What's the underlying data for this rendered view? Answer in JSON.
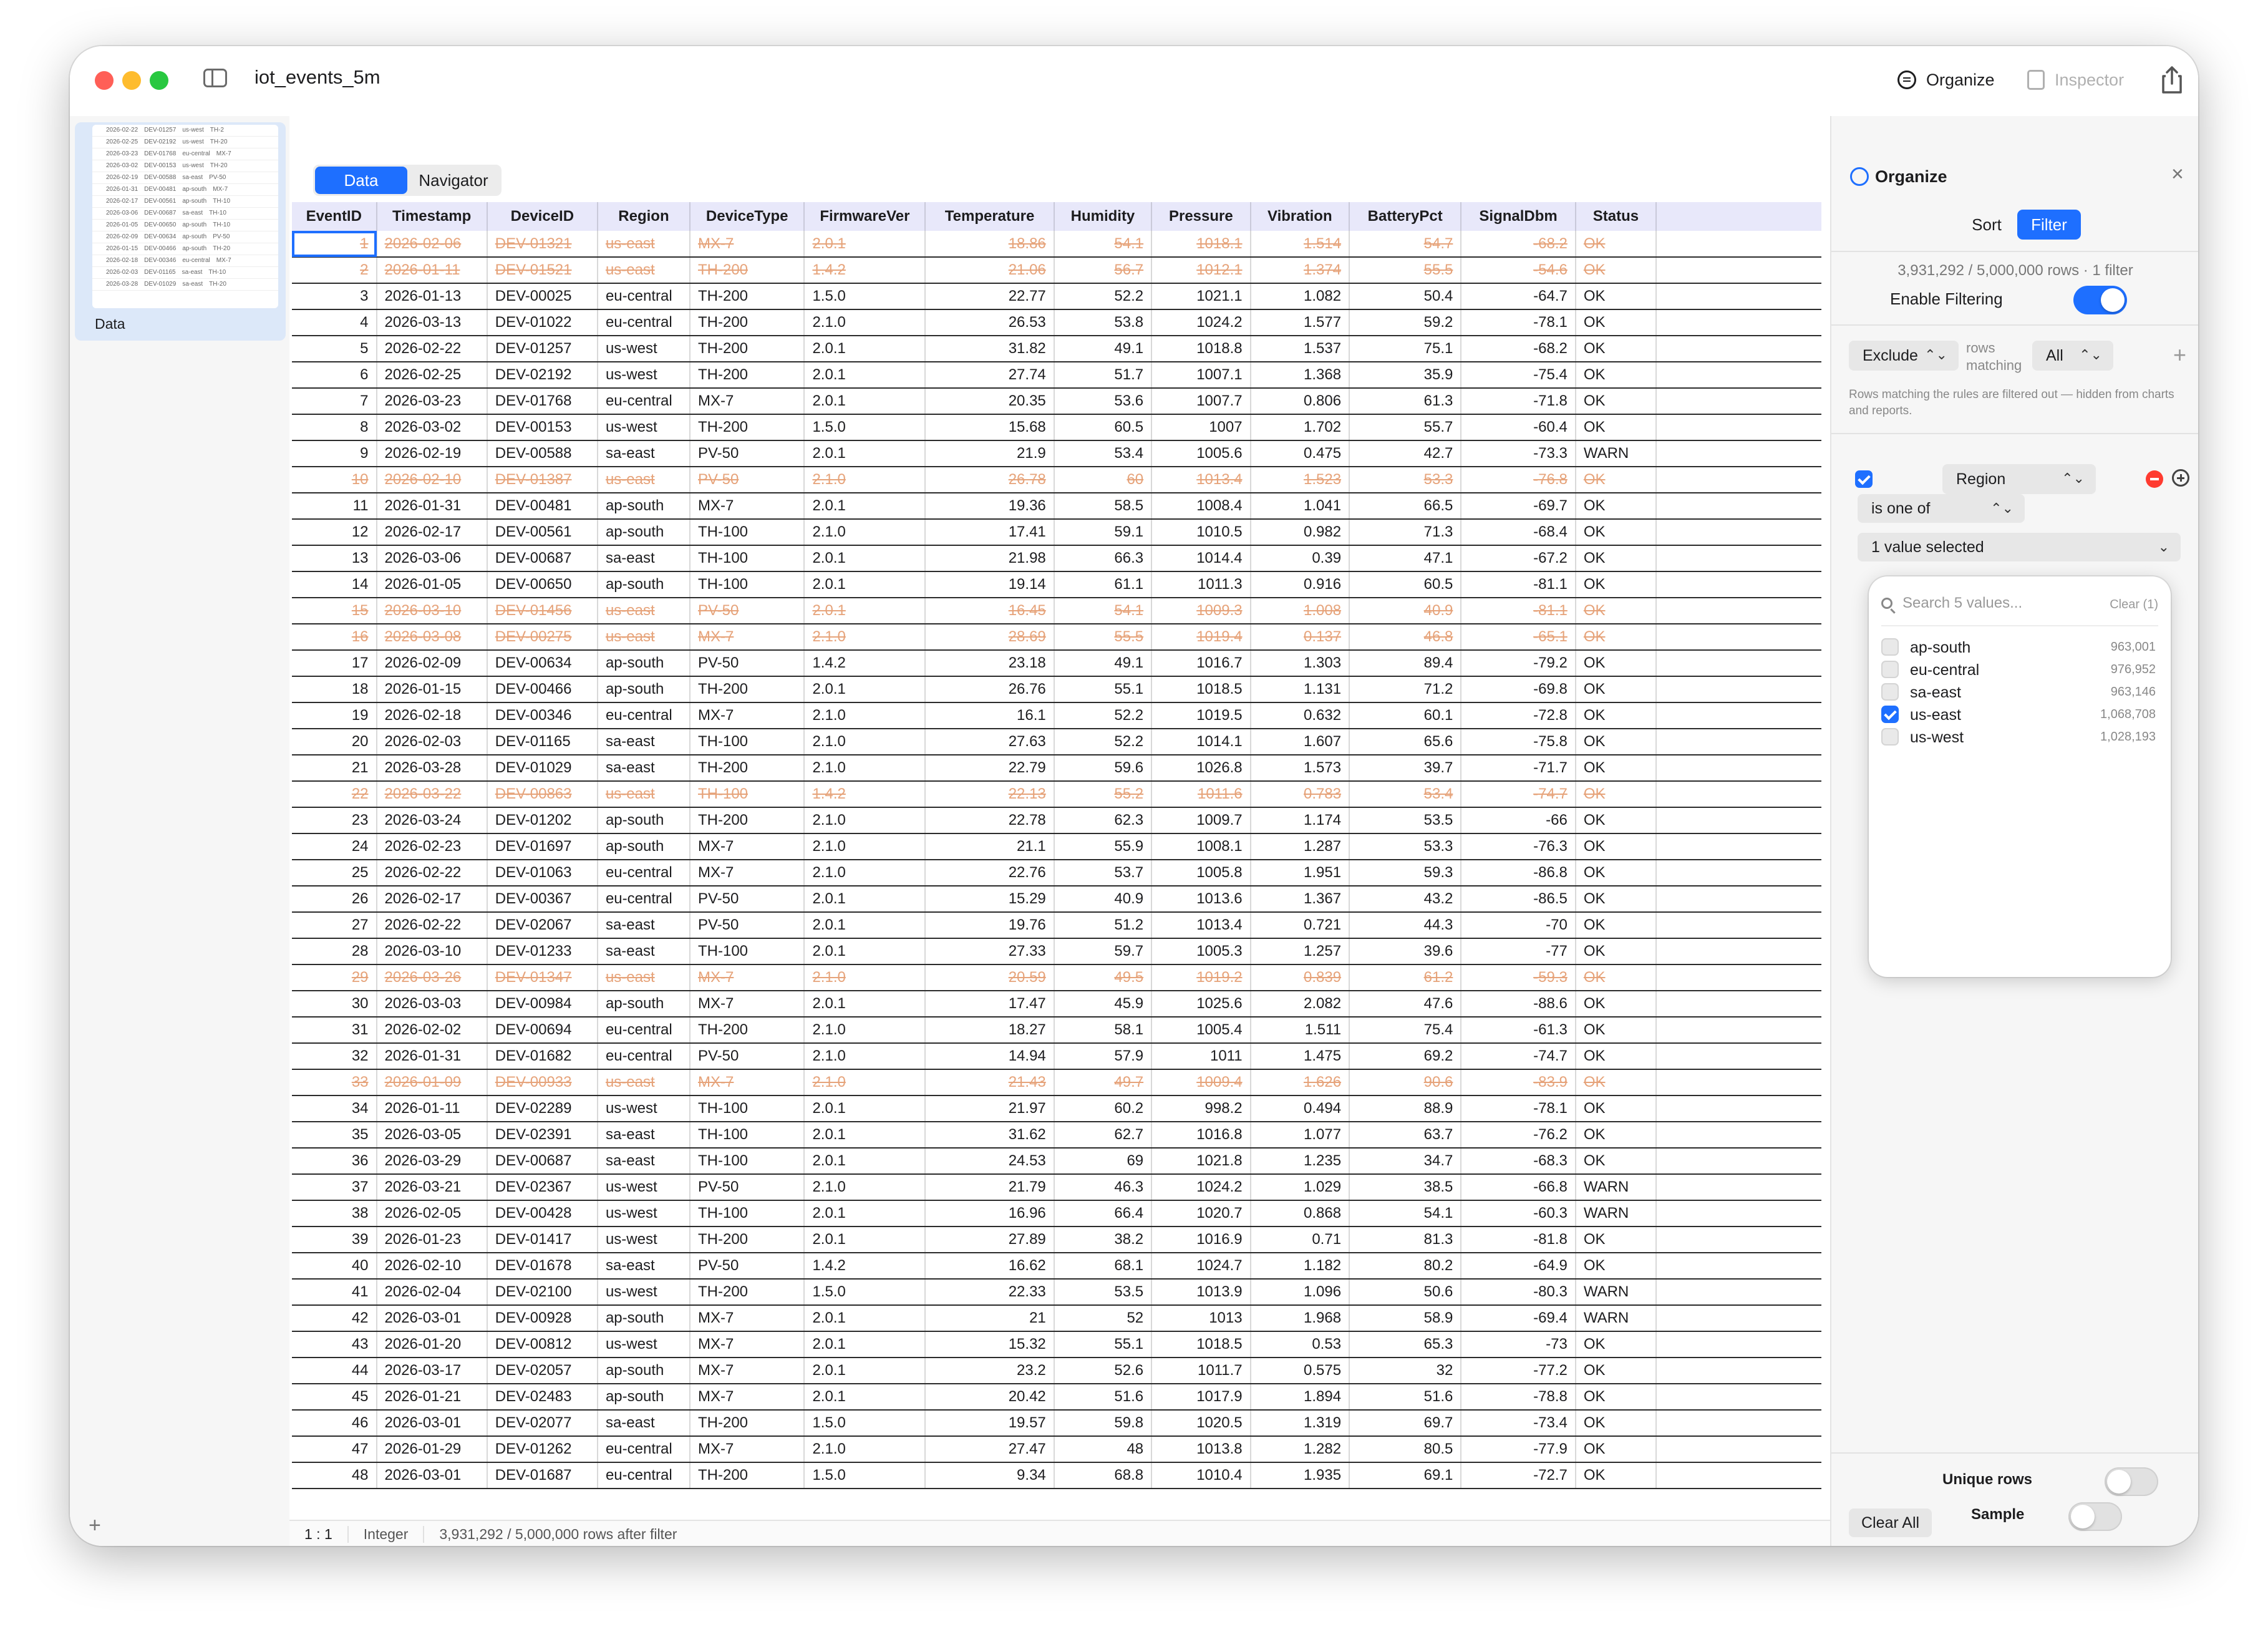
{
  "window": {
    "title": "iot_events_5m"
  },
  "toolbar": {
    "organize_label": "Organize",
    "inspector_label": "Inspector"
  },
  "sidebar": {
    "item_label": "Data",
    "thumbnail_rows": [
      [
        "2026-02-22",
        "DEV-01257",
        "us-west",
        "TH-2"
      ],
      [
        "2026-02-25",
        "DEV-02192",
        "us-west",
        "TH-20"
      ],
      [
        "2026-03-23",
        "DEV-01768",
        "eu-central",
        "MX-7"
      ],
      [
        "2026-03-02",
        "DEV-00153",
        "us-west",
        "TH-20"
      ],
      [
        "2026-02-19",
        "DEV-00588",
        "sa-east",
        "PV-50"
      ],
      [
        "2026-01-31",
        "DEV-00481",
        "ap-south",
        "MX-7"
      ],
      [
        "2026-02-17",
        "DEV-00561",
        "ap-south",
        "TH-10"
      ],
      [
        "2026-03-06",
        "DEV-00687",
        "sa-east",
        "TH-10"
      ],
      [
        "2026-01-05",
        "DEV-00650",
        "ap-south",
        "TH-10"
      ],
      [
        "2026-02-09",
        "DEV-00634",
        "ap-south",
        "PV-50"
      ],
      [
        "2026-01-15",
        "DEV-00466",
        "ap-south",
        "TH-20"
      ],
      [
        "2026-02-18",
        "DEV-00346",
        "eu-central",
        "MX-7"
      ],
      [
        "2026-02-03",
        "DEV-01165",
        "sa-east",
        "TH-10"
      ],
      [
        "2026-03-28",
        "DEV-01029",
        "sa-east",
        "TH-20"
      ]
    ]
  },
  "tabs": [
    "Data",
    "Navigator"
  ],
  "table": {
    "columns": [
      "EventID",
      "Timestamp",
      "DeviceID",
      "Region",
      "DeviceType",
      "FirmwareVer",
      "Temperature",
      "Humidity",
      "Pressure",
      "Vibration",
      "BatteryPct",
      "SignalDbm",
      "Status"
    ],
    "rows": [
      {
        "excluded": true,
        "cells": [
          "1",
          "2026-02-06",
          "DEV-01321",
          "us-east",
          "MX-7",
          "2.0.1",
          "18.86",
          "54.1",
          "1018.1",
          "1.514",
          "54.7",
          "-68.2",
          "OK"
        ]
      },
      {
        "excluded": true,
        "cells": [
          "2",
          "2026-01-11",
          "DEV-01521",
          "us-east",
          "TH-200",
          "1.4.2",
          "21.06",
          "56.7",
          "1012.1",
          "1.374",
          "55.5",
          "-54.6",
          "OK"
        ]
      },
      {
        "excluded": false,
        "cells": [
          "3",
          "2026-01-13",
          "DEV-00025",
          "eu-central",
          "TH-200",
          "1.5.0",
          "22.77",
          "52.2",
          "1021.1",
          "1.082",
          "50.4",
          "-64.7",
          "OK"
        ]
      },
      {
        "excluded": false,
        "cells": [
          "4",
          "2026-03-13",
          "DEV-01022",
          "eu-central",
          "TH-200",
          "2.1.0",
          "26.53",
          "53.8",
          "1024.2",
          "1.577",
          "59.2",
          "-78.1",
          "OK"
        ]
      },
      {
        "excluded": false,
        "cells": [
          "5",
          "2026-02-22",
          "DEV-01257",
          "us-west",
          "TH-200",
          "2.0.1",
          "31.82",
          "49.1",
          "1018.8",
          "1.537",
          "75.1",
          "-68.2",
          "OK"
        ]
      },
      {
        "excluded": false,
        "cells": [
          "6",
          "2026-02-25",
          "DEV-02192",
          "us-west",
          "TH-200",
          "2.0.1",
          "27.74",
          "51.7",
          "1007.1",
          "1.368",
          "35.9",
          "-75.4",
          "OK"
        ]
      },
      {
        "excluded": false,
        "cells": [
          "7",
          "2026-03-23",
          "DEV-01768",
          "eu-central",
          "MX-7",
          "2.0.1",
          "20.35",
          "53.6",
          "1007.7",
          "0.806",
          "61.3",
          "-71.8",
          "OK"
        ]
      },
      {
        "excluded": false,
        "cells": [
          "8",
          "2026-03-02",
          "DEV-00153",
          "us-west",
          "TH-200",
          "1.5.0",
          "15.68",
          "60.5",
          "1007",
          "1.702",
          "55.7",
          "-60.4",
          "OK"
        ]
      },
      {
        "excluded": false,
        "cells": [
          "9",
          "2026-02-19",
          "DEV-00588",
          "sa-east",
          "PV-50",
          "2.0.1",
          "21.9",
          "53.4",
          "1005.6",
          "0.475",
          "42.7",
          "-73.3",
          "WARN"
        ]
      },
      {
        "excluded": true,
        "cells": [
          "10",
          "2026-02-10",
          "DEV-01387",
          "us-east",
          "PV-50",
          "2.1.0",
          "26.78",
          "60",
          "1013.4",
          "1.523",
          "53.3",
          "-76.8",
          "OK"
        ]
      },
      {
        "excluded": false,
        "cells": [
          "11",
          "2026-01-31",
          "DEV-00481",
          "ap-south",
          "MX-7",
          "2.0.1",
          "19.36",
          "58.5",
          "1008.4",
          "1.041",
          "66.5",
          "-69.7",
          "OK"
        ]
      },
      {
        "excluded": false,
        "cells": [
          "12",
          "2026-02-17",
          "DEV-00561",
          "ap-south",
          "TH-100",
          "2.1.0",
          "17.41",
          "59.1",
          "1010.5",
          "0.982",
          "71.3",
          "-68.4",
          "OK"
        ]
      },
      {
        "excluded": false,
        "cells": [
          "13",
          "2026-03-06",
          "DEV-00687",
          "sa-east",
          "TH-100",
          "2.0.1",
          "21.98",
          "66.3",
          "1014.4",
          "0.39",
          "47.1",
          "-67.2",
          "OK"
        ]
      },
      {
        "excluded": false,
        "cells": [
          "14",
          "2026-01-05",
          "DEV-00650",
          "ap-south",
          "TH-100",
          "2.0.1",
          "19.14",
          "61.1",
          "1011.3",
          "0.916",
          "60.5",
          "-81.1",
          "OK"
        ]
      },
      {
        "excluded": true,
        "cells": [
          "15",
          "2026-03-10",
          "DEV-01456",
          "us-east",
          "PV-50",
          "2.0.1",
          "16.45",
          "54.1",
          "1009.3",
          "1.008",
          "40.9",
          "-81.1",
          "OK"
        ]
      },
      {
        "excluded": true,
        "cells": [
          "16",
          "2026-03-08",
          "DEV-00275",
          "us-east",
          "MX-7",
          "2.1.0",
          "28.69",
          "55.5",
          "1019.4",
          "0.137",
          "46.8",
          "-65.1",
          "OK"
        ]
      },
      {
        "excluded": false,
        "cells": [
          "17",
          "2026-02-09",
          "DEV-00634",
          "ap-south",
          "PV-50",
          "1.4.2",
          "23.18",
          "49.1",
          "1016.7",
          "1.303",
          "89.4",
          "-79.2",
          "OK"
        ]
      },
      {
        "excluded": false,
        "cells": [
          "18",
          "2026-01-15",
          "DEV-00466",
          "ap-south",
          "TH-200",
          "2.0.1",
          "26.76",
          "55.1",
          "1018.5",
          "1.131",
          "71.2",
          "-69.8",
          "OK"
        ]
      },
      {
        "excluded": false,
        "cells": [
          "19",
          "2026-02-18",
          "DEV-00346",
          "eu-central",
          "MX-7",
          "2.1.0",
          "16.1",
          "52.2",
          "1019.5",
          "0.632",
          "60.1",
          "-72.8",
          "OK"
        ]
      },
      {
        "excluded": false,
        "cells": [
          "20",
          "2026-02-03",
          "DEV-01165",
          "sa-east",
          "TH-100",
          "2.1.0",
          "27.63",
          "52.2",
          "1014.1",
          "1.607",
          "65.6",
          "-75.8",
          "OK"
        ]
      },
      {
        "excluded": false,
        "cells": [
          "21",
          "2026-03-28",
          "DEV-01029",
          "sa-east",
          "TH-200",
          "2.1.0",
          "22.79",
          "59.6",
          "1026.8",
          "1.573",
          "39.7",
          "-71.7",
          "OK"
        ]
      },
      {
        "excluded": true,
        "cells": [
          "22",
          "2026-03-22",
          "DEV-00863",
          "us-east",
          "TH-100",
          "1.4.2",
          "22.13",
          "55.2",
          "1011.6",
          "0.783",
          "53.4",
          "-74.7",
          "OK"
        ]
      },
      {
        "excluded": false,
        "cells": [
          "23",
          "2026-03-24",
          "DEV-01202",
          "ap-south",
          "TH-200",
          "2.1.0",
          "22.78",
          "62.3",
          "1009.7",
          "1.174",
          "53.5",
          "-66",
          "OK"
        ]
      },
      {
        "excluded": false,
        "cells": [
          "24",
          "2026-02-23",
          "DEV-01697",
          "ap-south",
          "MX-7",
          "2.1.0",
          "21.1",
          "55.9",
          "1008.1",
          "1.287",
          "53.3",
          "-76.3",
          "OK"
        ]
      },
      {
        "excluded": false,
        "cells": [
          "25",
          "2026-02-22",
          "DEV-01063",
          "eu-central",
          "MX-7",
          "2.1.0",
          "22.76",
          "53.7",
          "1005.8",
          "1.951",
          "59.3",
          "-86.8",
          "OK"
        ]
      },
      {
        "excluded": false,
        "cells": [
          "26",
          "2026-02-17",
          "DEV-00367",
          "eu-central",
          "PV-50",
          "2.0.1",
          "15.29",
          "40.9",
          "1013.6",
          "1.367",
          "43.2",
          "-86.5",
          "OK"
        ]
      },
      {
        "excluded": false,
        "cells": [
          "27",
          "2026-02-22",
          "DEV-02067",
          "sa-east",
          "PV-50",
          "2.0.1",
          "19.76",
          "51.2",
          "1013.4",
          "0.721",
          "44.3",
          "-70",
          "OK"
        ]
      },
      {
        "excluded": false,
        "cells": [
          "28",
          "2026-03-10",
          "DEV-01233",
          "sa-east",
          "TH-100",
          "2.0.1",
          "27.33",
          "59.7",
          "1005.3",
          "1.257",
          "39.6",
          "-77",
          "OK"
        ]
      },
      {
        "excluded": true,
        "cells": [
          "29",
          "2026-03-26",
          "DEV-01347",
          "us-east",
          "MX-7",
          "2.1.0",
          "20.59",
          "49.5",
          "1019.2",
          "0.839",
          "61.2",
          "-59.3",
          "OK"
        ]
      },
      {
        "excluded": false,
        "cells": [
          "30",
          "2026-03-03",
          "DEV-00984",
          "ap-south",
          "MX-7",
          "2.0.1",
          "17.47",
          "45.9",
          "1025.6",
          "2.082",
          "47.6",
          "-88.6",
          "OK"
        ]
      },
      {
        "excluded": false,
        "cells": [
          "31",
          "2026-02-02",
          "DEV-00694",
          "eu-central",
          "TH-200",
          "2.1.0",
          "18.27",
          "58.1",
          "1005.4",
          "1.511",
          "75.4",
          "-61.3",
          "OK"
        ]
      },
      {
        "excluded": false,
        "cells": [
          "32",
          "2026-01-31",
          "DEV-01682",
          "eu-central",
          "PV-50",
          "2.1.0",
          "14.94",
          "57.9",
          "1011",
          "1.475",
          "69.2",
          "-74.7",
          "OK"
        ]
      },
      {
        "excluded": true,
        "cells": [
          "33",
          "2026-01-09",
          "DEV-00933",
          "us-east",
          "MX-7",
          "2.1.0",
          "21.43",
          "49.7",
          "1009.4",
          "1.626",
          "90.6",
          "-83.9",
          "OK"
        ]
      },
      {
        "excluded": false,
        "cells": [
          "34",
          "2026-01-11",
          "DEV-02289",
          "us-west",
          "TH-100",
          "2.0.1",
          "21.97",
          "60.2",
          "998.2",
          "0.494",
          "88.9",
          "-78.1",
          "OK"
        ]
      },
      {
        "excluded": false,
        "cells": [
          "35",
          "2026-03-05",
          "DEV-02391",
          "sa-east",
          "TH-100",
          "2.0.1",
          "31.62",
          "62.7",
          "1016.8",
          "1.077",
          "63.7",
          "-76.2",
          "OK"
        ]
      },
      {
        "excluded": false,
        "cells": [
          "36",
          "2026-03-29",
          "DEV-00687",
          "sa-east",
          "TH-100",
          "2.0.1",
          "24.53",
          "69",
          "1021.8",
          "1.235",
          "34.7",
          "-68.3",
          "OK"
        ]
      },
      {
        "excluded": false,
        "cells": [
          "37",
          "2026-03-21",
          "DEV-02367",
          "us-west",
          "PV-50",
          "2.1.0",
          "21.79",
          "46.3",
          "1024.2",
          "1.029",
          "38.5",
          "-66.8",
          "WARN"
        ]
      },
      {
        "excluded": false,
        "cells": [
          "38",
          "2026-02-05",
          "DEV-00428",
          "us-west",
          "TH-100",
          "2.0.1",
          "16.96",
          "66.4",
          "1020.7",
          "0.868",
          "54.1",
          "-60.3",
          "WARN"
        ]
      },
      {
        "excluded": false,
        "cells": [
          "39",
          "2026-01-23",
          "DEV-01417",
          "us-west",
          "TH-200",
          "2.0.1",
          "27.89",
          "38.2",
          "1016.9",
          "0.71",
          "81.3",
          "-81.8",
          "OK"
        ]
      },
      {
        "excluded": false,
        "cells": [
          "40",
          "2026-02-10",
          "DEV-01678",
          "sa-east",
          "PV-50",
          "1.4.2",
          "16.62",
          "68.1",
          "1024.7",
          "1.182",
          "80.2",
          "-64.9",
          "OK"
        ]
      },
      {
        "excluded": false,
        "cells": [
          "41",
          "2026-02-04",
          "DEV-02100",
          "us-west",
          "TH-200",
          "1.5.0",
          "22.33",
          "53.5",
          "1013.9",
          "1.096",
          "50.6",
          "-80.3",
          "WARN"
        ]
      },
      {
        "excluded": false,
        "cells": [
          "42",
          "2026-03-01",
          "DEV-00928",
          "ap-south",
          "MX-7",
          "2.0.1",
          "21",
          "52",
          "1013",
          "1.968",
          "58.9",
          "-69.4",
          "WARN"
        ]
      },
      {
        "excluded": false,
        "cells": [
          "43",
          "2026-01-20",
          "DEV-00812",
          "us-west",
          "MX-7",
          "2.0.1",
          "15.32",
          "55.1",
          "1018.5",
          "0.53",
          "65.3",
          "-73",
          "OK"
        ]
      },
      {
        "excluded": false,
        "cells": [
          "44",
          "2026-03-17",
          "DEV-02057",
          "ap-south",
          "MX-7",
          "2.0.1",
          "23.2",
          "52.6",
          "1011.7",
          "0.575",
          "32",
          "-77.2",
          "OK"
        ]
      },
      {
        "excluded": false,
        "cells": [
          "45",
          "2026-01-21",
          "DEV-02483",
          "ap-south",
          "MX-7",
          "2.0.1",
          "20.42",
          "51.6",
          "1017.9",
          "1.894",
          "51.6",
          "-78.8",
          "OK"
        ]
      },
      {
        "excluded": false,
        "cells": [
          "46",
          "2026-03-01",
          "DEV-02077",
          "sa-east",
          "TH-200",
          "1.5.0",
          "19.57",
          "59.8",
          "1020.5",
          "1.319",
          "69.7",
          "-73.4",
          "OK"
        ]
      },
      {
        "excluded": false,
        "cells": [
          "47",
          "2026-01-29",
          "DEV-01262",
          "eu-central",
          "MX-7",
          "2.1.0",
          "27.47",
          "48",
          "1013.8",
          "1.282",
          "80.5",
          "-77.9",
          "OK"
        ]
      },
      {
        "excluded": false,
        "cells": [
          "48",
          "2026-03-01",
          "DEV-01687",
          "eu-central",
          "TH-200",
          "1.5.0",
          "9.34",
          "68.8",
          "1010.4",
          "1.935",
          "69.1",
          "-72.7",
          "OK"
        ]
      }
    ]
  },
  "statusbar": {
    "position": "1 : 1",
    "type": "Integer",
    "summary": "3,931,292 / 5,000,000 rows after filter"
  },
  "panel": {
    "title": "Organize",
    "tabs": [
      "Sort",
      "Filter"
    ],
    "count_text": "3,931,292 / 5,000,000 rows · 1 filter",
    "enable_label": "Enable Filtering",
    "enable_on": true,
    "mode_value": "Exclude",
    "rows_matching_label": "rows matching",
    "match_value": "All",
    "help_text": "Rows matching the rules are filtered out — hidden from charts and reports.",
    "rule": {
      "enabled": true,
      "field": "Region",
      "operator": "is one of",
      "value_summary": "1 value selected"
    },
    "dropdown": {
      "search_placeholder": "Search 5 values...",
      "clear_label": "Clear (1)",
      "options": [
        {
          "name": "ap-south",
          "count": "963,001",
          "checked": false
        },
        {
          "name": "eu-central",
          "count": "976,952",
          "checked": false
        },
        {
          "name": "sa-east",
          "count": "963,146",
          "checked": false
        },
        {
          "name": "us-east",
          "count": "1,068,708",
          "checked": true
        },
        {
          "name": "us-west",
          "count": "1,028,193",
          "checked": false
        }
      ]
    },
    "unique_rows_label": "Unique rows",
    "unique_rows_on": false,
    "sample_label": "Sample",
    "sample_on": false,
    "clear_all_label": "Clear All"
  },
  "colors": {
    "accent": "#1e6fff",
    "excluded_text": "#e6a37a",
    "header_bg": "#e8e8fa"
  }
}
